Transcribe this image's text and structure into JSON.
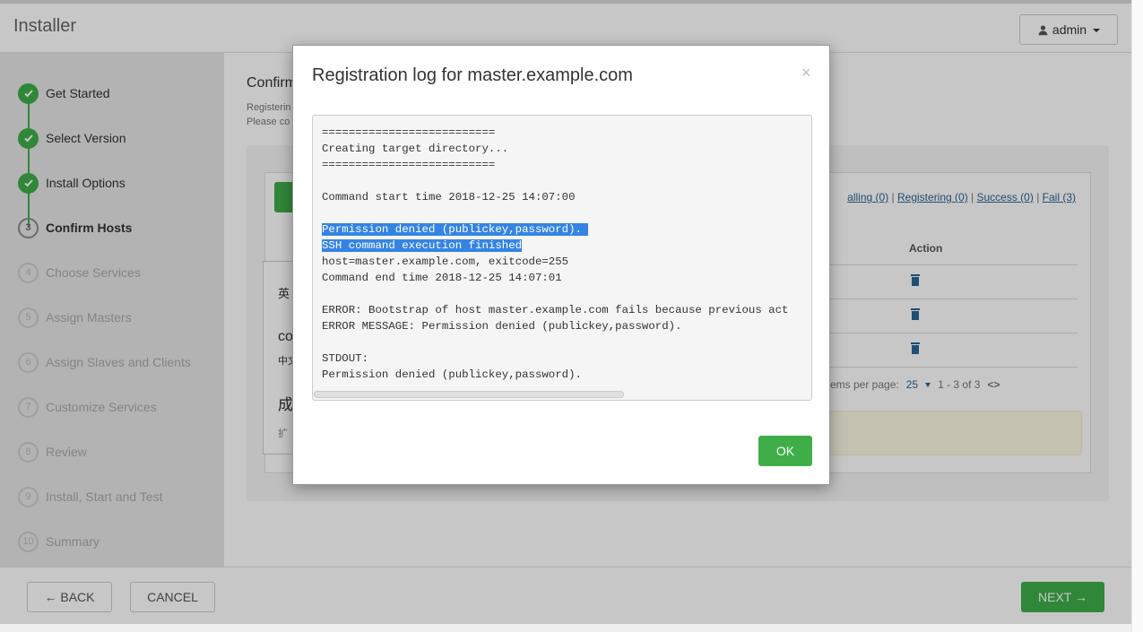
{
  "header": {
    "app_title": "Installer",
    "user_label": "admin"
  },
  "sidebar": {
    "steps": [
      {
        "num": "1",
        "label": "Get Started",
        "state": "done"
      },
      {
        "num": "2",
        "label": "Select Version",
        "state": "done"
      },
      {
        "num": "3",
        "label": "Install Options",
        "state": "done"
      },
      {
        "num": "3",
        "label": "Confirm Hosts",
        "state": "current"
      },
      {
        "num": "4",
        "label": "Choose Services",
        "state": "todo"
      },
      {
        "num": "5",
        "label": "Assign Masters",
        "state": "todo"
      },
      {
        "num": "6",
        "label": "Assign Slaves and Clients",
        "state": "todo"
      },
      {
        "num": "7",
        "label": "Customize Services",
        "state": "todo"
      },
      {
        "num": "8",
        "label": "Review",
        "state": "todo"
      },
      {
        "num": "9",
        "label": "Install, Start and Test",
        "state": "todo"
      },
      {
        "num": "10",
        "label": "Summary",
        "state": "todo"
      }
    ]
  },
  "content": {
    "title": "Confirm",
    "sub1": "Registerin",
    "sub2": "Please co",
    "filters": {
      "installing": "alling (0)",
      "registering": "Registering (0)",
      "success": "Success (0)",
      "fail": "Fail (3)"
    },
    "table": {
      "action_header": "Action"
    },
    "pager": {
      "label": "ems per page:",
      "per_page": "25",
      "range": "1 - 3 of 3",
      "nav": "<>"
    },
    "popup_lines": [
      "英",
      "co",
      "中文",
      "成",
      "扩"
    ]
  },
  "footer": {
    "back_label": "← BACK",
    "cancel_label": "CANCEL",
    "next_label": "NEXT →"
  },
  "modal": {
    "title": "Registration log for master.example.com",
    "close": "×",
    "ok_label": "OK",
    "log_lines": [
      "==========================",
      "Creating target directory...",
      "==========================",
      "",
      "Command start time 2018-12-25 14:07:00",
      "",
      "Permission denied (publickey,password). ",
      "SSH command execution finished",
      "host=master.example.com, exitcode=255",
      "Command end time 2018-12-25 14:07:01",
      "",
      "ERROR: Bootstrap of host master.example.com fails because previous act",
      "ERROR MESSAGE: Permission denied (publickey,password).",
      "",
      "STDOUT:",
      "Permission denied (publickey,password)."
    ],
    "highlighted_lines": [
      6,
      7
    ]
  },
  "colors": {
    "success": "#3fae49",
    "link": "#2a6496",
    "selection": "#3584e4"
  }
}
